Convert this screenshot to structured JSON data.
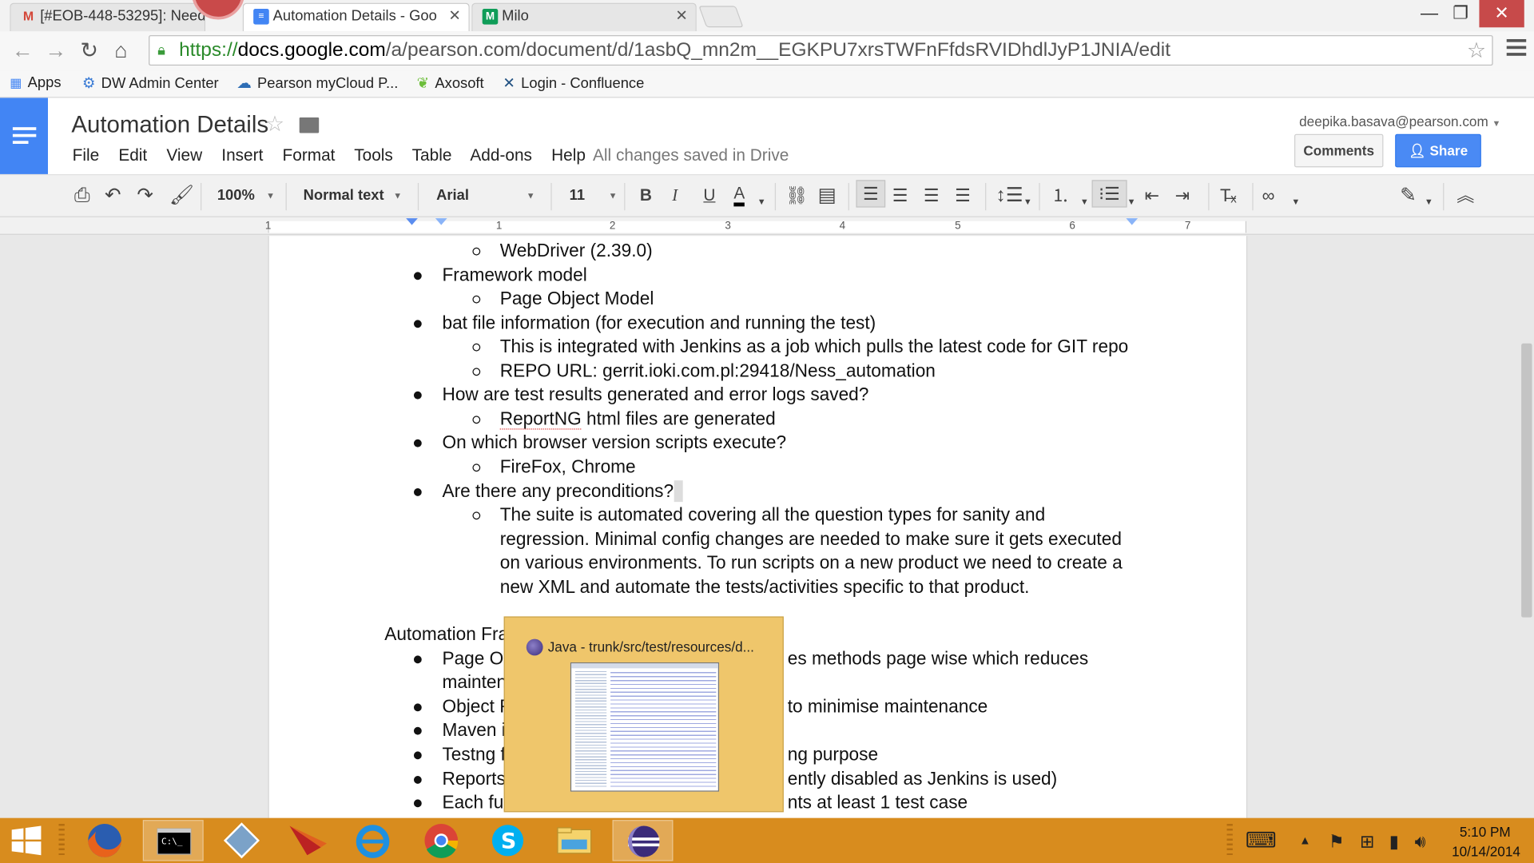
{
  "browser": {
    "tabs": [
      {
        "label": "[#EOB-448-53295]: Need",
        "icon": "gmail-icon",
        "active": false
      },
      {
        "label": "Automation Details - Goo",
        "icon": "docs-icon",
        "active": true
      },
      {
        "label": "Milo",
        "icon": "sheets-icon",
        "active": false
      }
    ],
    "url": {
      "scheme": "https://",
      "host": "docs.google.com",
      "path": "/a/pearson.com/document/d/1asbQ_mn2m__EGKPU7xrsTWFnFfdsRVIDhdlJyP1JNIA/edit"
    },
    "bookmarks": [
      "Apps",
      "DW Admin Center",
      "Pearson myCloud P...",
      "Axosoft",
      "Login - Confluence"
    ]
  },
  "docs": {
    "title": "Automation Details",
    "menu": [
      "File",
      "Edit",
      "View",
      "Insert",
      "Format",
      "Tools",
      "Table",
      "Add-ons",
      "Help"
    ],
    "save_status": "All changes saved in Drive",
    "user_email": "deepika.basava@pearson.com",
    "comments_label": "Comments",
    "share_label": "Share",
    "toolbar": {
      "zoom": "100%",
      "style": "Normal text",
      "font": "Arial",
      "size": "11"
    },
    "ruler_numbers": [
      "1",
      "1",
      "2",
      "3",
      "4",
      "5",
      "6",
      "7"
    ]
  },
  "document": {
    "lines": [
      {
        "level": 2,
        "text": "WebDriver (2.39.0)"
      },
      {
        "level": 1,
        "text": "Framework model"
      },
      {
        "level": 2,
        "text": "Page Object Model"
      },
      {
        "level": 1,
        "text": "bat file information (for execution and running the test)"
      },
      {
        "level": 2,
        "text": "This is integrated with Jenkins as a job which pulls the latest code for GIT repo"
      },
      {
        "level": 2,
        "text": "REPO URL: gerrit.ioki.com.pl:29418/Ness_automation"
      },
      {
        "level": 1,
        "text": "How are test results generated and error logs saved?"
      },
      {
        "level": 2,
        "text": "ReportNG html files are generated"
      },
      {
        "level": 1,
        "text": "On which browser version scripts execute?"
      },
      {
        "level": 2,
        "text": "FireFox, Chrome"
      },
      {
        "level": 1,
        "text": "Are there any preconditions?"
      },
      {
        "level": 2,
        "text": "The suite is automated covering all the question types for sanity and"
      },
      {
        "level": 3,
        "text": "regression. Minimal config changes are needed to make sure it gets executed"
      },
      {
        "level": 3,
        "text": "on various environments. To run scripts on a new product we need to create a"
      },
      {
        "level": 3,
        "text": "new XML and automate the tests/activities specific to that product."
      },
      {
        "level": 0,
        "text": "Automation Fra"
      },
      {
        "level": 1,
        "text": "Page O"
      },
      {
        "level": 3,
        "text": "es methods page wise which reduces"
      },
      {
        "level": 4,
        "text": "mainten"
      },
      {
        "level": 1,
        "text": "Object F"
      },
      {
        "level": 3,
        "text": "to minimise maintenance"
      },
      {
        "level": 1,
        "text": "Maven i"
      },
      {
        "level": 1,
        "text": "Testng f"
      },
      {
        "level": 3,
        "text": "ng purpose"
      },
      {
        "level": 1,
        "text": "Reports"
      },
      {
        "level": 3,
        "text": "ently disabled as Jenkins is used)"
      },
      {
        "level": 1,
        "text": "Each fu"
      },
      {
        "level": 3,
        "text": "nts at least 1 test case"
      }
    ]
  },
  "taskbar_preview": {
    "title": "Java - trunk/src/test/resources/d..."
  },
  "taskbar": {
    "apps": [
      "firefox-icon",
      "cmd-icon",
      "vmware-icon",
      "matlab-icon",
      "ie-icon",
      "chrome-icon",
      "skype-icon",
      "explorer-icon",
      "eclipse-icon"
    ],
    "time": "5:10 PM",
    "date": "10/14/2014"
  },
  "colors": {
    "docs_blue": "#4285f4",
    "share_blue": "#4a8af4",
    "taskbar": "#d88c1e",
    "preview": "#efc66b"
  }
}
